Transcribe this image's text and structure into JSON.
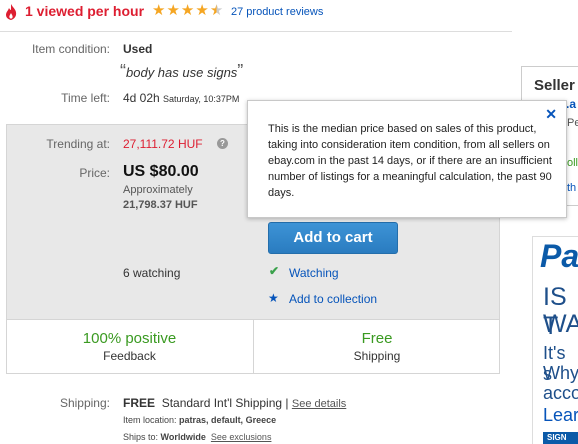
{
  "top": {
    "viewed_text": "1 viewed per hour",
    "rating_stars": 4.5,
    "reviews_text": "27 product reviews"
  },
  "item": {
    "condition_label": "Item condition:",
    "condition_value": "Used",
    "condition_note": "body has use signs",
    "time_left_label": "Time left:",
    "time_left_value": "4d 02h",
    "time_left_detail": "Saturday, 10:37PM"
  },
  "pricing": {
    "trending_label": "Trending at:",
    "trending_value": "27,111.72 HUF",
    "price_label": "Price:",
    "price_value": "US $80.00",
    "approx_label": "Approximately",
    "approx_value": "21,798.37 HUF",
    "add_to_cart": "Add to cart",
    "watching_count": "6 watching",
    "watching_link": "Watching",
    "collection_link": "Add to collection"
  },
  "highlights": {
    "feedback_value": "100% positive",
    "feedback_label": "Feedback",
    "shipping_value": "Free",
    "shipping_label": "Shipping"
  },
  "shipping": {
    "label": "Shipping:",
    "cost": "FREE",
    "service": "Standard Int'l Shipping |",
    "details_link": "See details",
    "location_label": "Item location:",
    "location_value": "patras, default, Greece",
    "ships_to_label": "Ships to:",
    "ships_to_value": "Worldwide",
    "exclusions_link": "See exclusions"
  },
  "tooltip": {
    "text": "This is the median price based on sales of this product, taking into consideration item condition, from all sellers on ebay.com in the past 14 days, or if there are an insufficient number of listings for a meaningful calculation, the past 90 days.",
    "close": "✕"
  },
  "seller": {
    "title": "Seller",
    "frag1": "r.a",
    "frag2": "Pe",
    "frag3": "oll",
    "frag4": "th"
  },
  "ad": {
    "brand": "Pa",
    "line1": "IS T",
    "line2": "WA",
    "line3": "It's s",
    "line4": "Why",
    "line5": "acco",
    "line6": "Lear",
    "button": "SIGN"
  },
  "colors": {
    "alert_red": "#dd1e31",
    "link_blue": "#0654ba",
    "positive_green": "#3a9a21",
    "star_gold": "#f5a623",
    "button_blue": "#2a7cc0"
  }
}
